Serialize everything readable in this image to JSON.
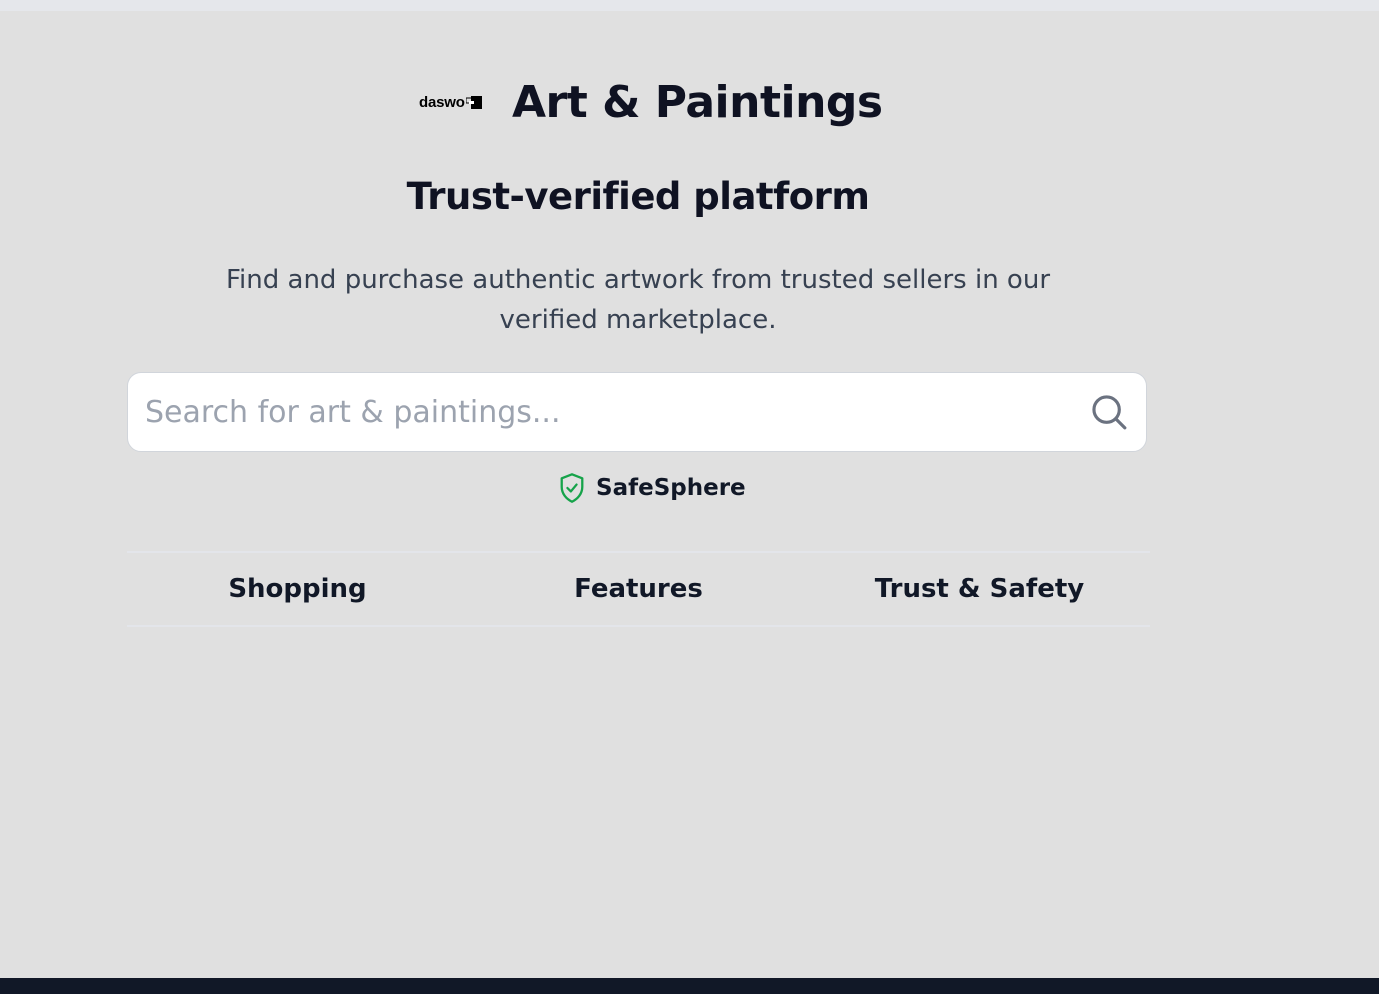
{
  "brand": {
    "logo_text": "daswo",
    "title": "Art & Paintings"
  },
  "hero": {
    "tagline": "Trust-verified platform",
    "description": "Find and purchase authentic artwork from trusted sellers in our verified marketplace."
  },
  "search": {
    "placeholder": "Search for art & paintings...",
    "value": ""
  },
  "trust_badge": {
    "label": "SafeSphere",
    "color": "#16a34a"
  },
  "tabs": [
    {
      "label": "Shopping"
    },
    {
      "label": "Features"
    },
    {
      "label": "Trust & Safety"
    }
  ],
  "colors": {
    "background": "#e0e0e0",
    "footer": "#111827",
    "text": "#0f1222",
    "muted": "#374151",
    "placeholder": "#9ca3af"
  }
}
